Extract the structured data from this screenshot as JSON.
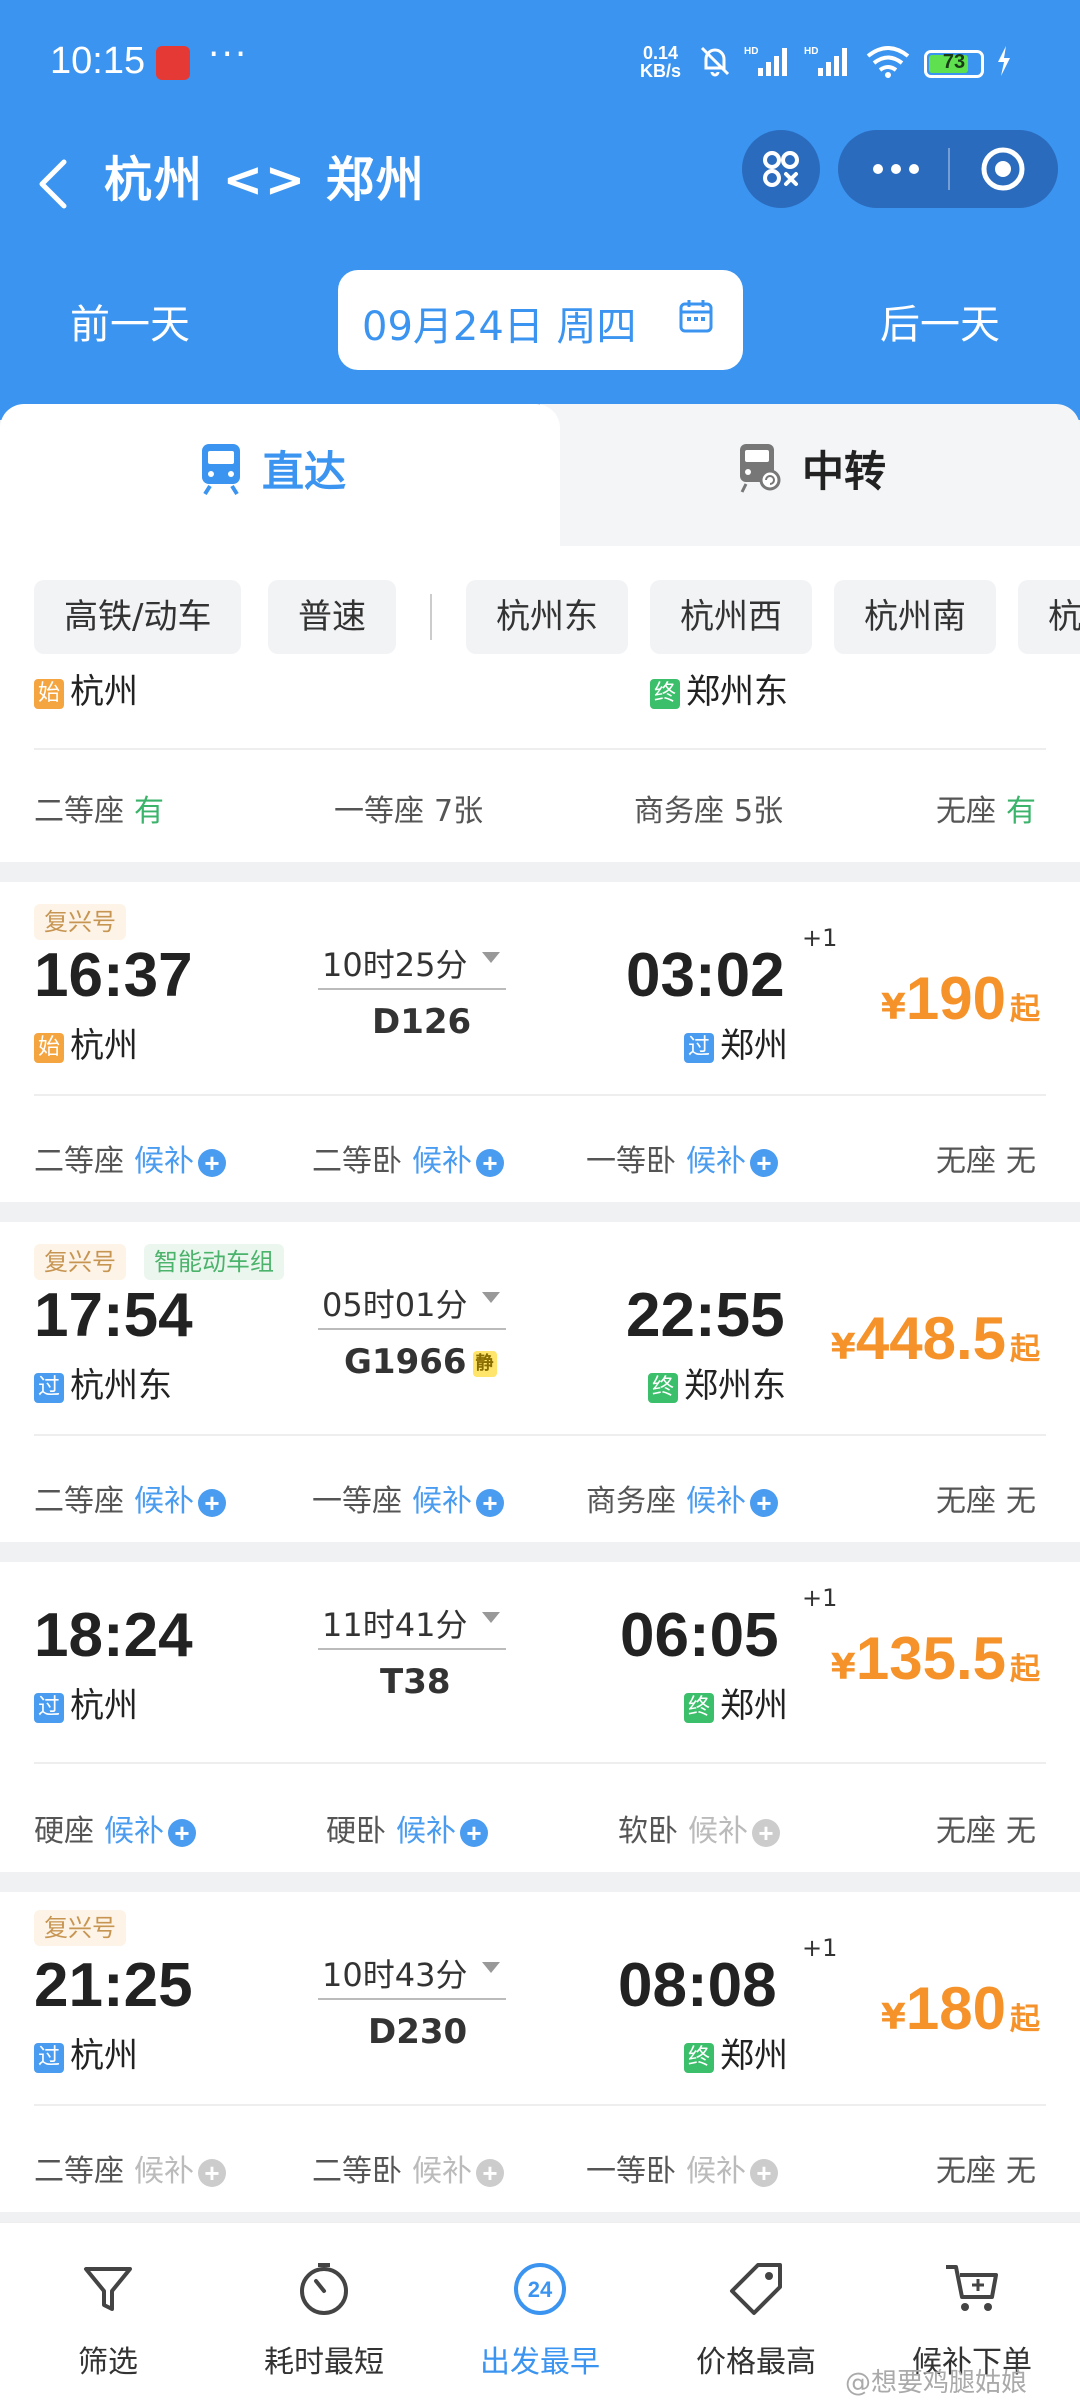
{
  "status_bar": {
    "time": "10:15",
    "net_speed_top": "0.14",
    "net_speed_bottom": "KB/s",
    "battery": "73"
  },
  "header": {
    "route": "杭州 <> 郑州"
  },
  "date_row": {
    "prev": "前一天",
    "date": "09月24日 周四",
    "next": "后一天"
  },
  "tabs": [
    {
      "label": "直达",
      "active": true
    },
    {
      "label": "中转",
      "active": false
    }
  ],
  "filters": [
    "高铁/动车",
    "普速",
    "杭州东",
    "杭州西",
    "杭州南",
    "杭"
  ],
  "partial_card": {
    "from": "杭州",
    "to": "郑州东",
    "seats": [
      {
        "name": "二等座",
        "status": "有"
      },
      {
        "name": "一等座",
        "status": "7张"
      },
      {
        "name": "商务座",
        "status": "5张"
      },
      {
        "name": "无座",
        "status": "有"
      }
    ]
  },
  "trains": [
    {
      "tags": [
        "复兴号"
      ],
      "dep_time": "16:37",
      "duration": "10时25分",
      "train_no": "D126",
      "jing": false,
      "arr_time": "03:02",
      "plus_day": "+1",
      "from_badge": "始",
      "from": "杭州",
      "to_badge": "过",
      "to": "郑州",
      "price_symbol": "¥",
      "price": "190",
      "price_suffix": "起",
      "seats": [
        {
          "name": "二等座",
          "status": "候补",
          "kind": "hb"
        },
        {
          "name": "二等卧",
          "status": "候补",
          "kind": "hb"
        },
        {
          "name": "一等卧",
          "status": "候补",
          "kind": "hb"
        },
        {
          "name": "无座",
          "status": "无",
          "kind": "no"
        }
      ]
    },
    {
      "tags": [
        "复兴号",
        "智能动车组"
      ],
      "dep_time": "17:54",
      "duration": "05时01分",
      "train_no": "G1966",
      "jing": true,
      "jing_label": "静",
      "arr_time": "22:55",
      "plus_day": "",
      "from_badge": "过",
      "from": "杭州东",
      "to_badge": "终",
      "to": "郑州东",
      "price_symbol": "¥",
      "price": "448.5",
      "price_suffix": "起",
      "seats": [
        {
          "name": "二等座",
          "status": "候补",
          "kind": "hb"
        },
        {
          "name": "一等座",
          "status": "候补",
          "kind": "hb"
        },
        {
          "name": "商务座",
          "status": "候补",
          "kind": "hb"
        },
        {
          "name": "无座",
          "status": "无",
          "kind": "no"
        }
      ]
    },
    {
      "tags": [],
      "dep_time": "18:24",
      "duration": "11时41分",
      "train_no": "T38",
      "jing": false,
      "arr_time": "06:05",
      "plus_day": "+1",
      "from_badge": "过",
      "from": "杭州",
      "to_badge": "终",
      "to": "郑州",
      "price_symbol": "¥",
      "price": "135.5",
      "price_suffix": "起",
      "seats": [
        {
          "name": "硬座",
          "status": "候补",
          "kind": "hb"
        },
        {
          "name": "硬卧",
          "status": "候补",
          "kind": "hb"
        },
        {
          "name": "软卧",
          "status": "候补",
          "kind": "gray"
        },
        {
          "name": "无座",
          "status": "无",
          "kind": "no"
        }
      ]
    },
    {
      "tags": [
        "复兴号"
      ],
      "dep_time": "21:25",
      "duration": "10时43分",
      "train_no": "D230",
      "jing": false,
      "arr_time": "08:08",
      "plus_day": "+1",
      "from_badge": "过",
      "from": "杭州",
      "to_badge": "终",
      "to": "郑州",
      "price_symbol": "¥",
      "price": "180",
      "price_suffix": "起",
      "seats": [
        {
          "name": "二等座",
          "status": "候补",
          "kind": "gray"
        },
        {
          "name": "二等卧",
          "status": "候补",
          "kind": "gray"
        },
        {
          "name": "一等卧",
          "status": "候补",
          "kind": "gray"
        },
        {
          "name": "无座",
          "status": "无",
          "kind": "no"
        }
      ]
    }
  ],
  "bottom_nav": [
    {
      "label": "筛选",
      "icon": "filter-icon",
      "active": false
    },
    {
      "label": "耗时最短",
      "icon": "timer-icon",
      "active": false
    },
    {
      "label": "出发最早",
      "icon": "clock-24-icon",
      "active": true
    },
    {
      "label": "价格最高",
      "icon": "price-tag-icon",
      "active": false
    },
    {
      "label": "候补下单",
      "icon": "cart-icon",
      "active": false
    }
  ],
  "watermark": "@想要鸡腿姑娘",
  "colors": {
    "brand_blue": "#3b94f0",
    "price_orange": "#f5922a",
    "available_green": "#3bb36b"
  }
}
